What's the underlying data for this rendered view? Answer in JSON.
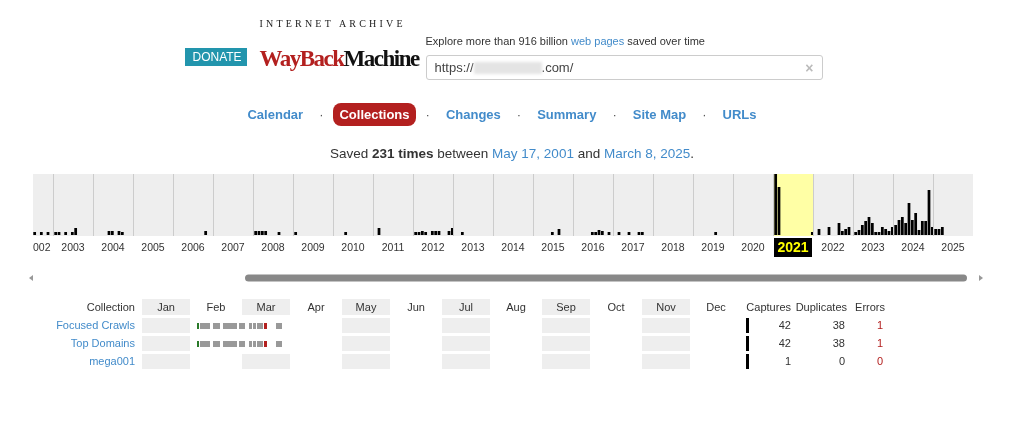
{
  "donate_button": "DONATE",
  "logo": {
    "top": "INTERNET ARCHIVE",
    "word_1": "WayBack",
    "word_2": "Machine"
  },
  "tagline": {
    "before": "Explore more than 916 billion ",
    "link": "web pages",
    "after": " saved over time"
  },
  "search": {
    "value_start": "https://",
    "value_end": ".com/",
    "clear": "×"
  },
  "tab_separator": "·",
  "tabs": [
    {
      "label": "Calendar",
      "selected": false
    },
    {
      "label": "Collections",
      "selected": true
    },
    {
      "label": "Changes",
      "selected": false
    },
    {
      "label": "Summary",
      "selected": false
    },
    {
      "label": "Site Map",
      "selected": false
    },
    {
      "label": "URLs",
      "selected": false
    }
  ],
  "summary": {
    "prefix": "Saved ",
    "count": "231 times",
    "middle": " between ",
    "first": "May 17, 2001",
    "join": " and ",
    "last": "March 8, 2025",
    "end": "."
  },
  "timeline": {
    "years": [
      {
        "label": "002",
        "selected": false
      },
      {
        "label": "2003",
        "selected": false
      },
      {
        "label": "2004",
        "selected": false
      },
      {
        "label": "2005",
        "selected": false
      },
      {
        "label": "2006",
        "selected": false
      },
      {
        "label": "2007",
        "selected": false
      },
      {
        "label": "2008",
        "selected": false
      },
      {
        "label": "2009",
        "selected": false
      },
      {
        "label": "2010",
        "selected": false
      },
      {
        "label": "2011",
        "selected": false
      },
      {
        "label": "2012",
        "selected": false
      },
      {
        "label": "2013",
        "selected": false
      },
      {
        "label": "2014",
        "selected": false
      },
      {
        "label": "2015",
        "selected": false
      },
      {
        "label": "2016",
        "selected": false
      },
      {
        "label": "2017",
        "selected": false
      },
      {
        "label": "2018",
        "selected": false
      },
      {
        "label": "2019",
        "selected": false
      },
      {
        "label": "2020",
        "selected": false
      },
      {
        "label": "2021",
        "selected": true
      },
      {
        "label": "2022",
        "selected": false
      },
      {
        "label": "2023",
        "selected": false
      },
      {
        "label": "2024",
        "selected": false
      },
      {
        "label": "2025",
        "selected": false
      }
    ]
  },
  "collections": {
    "columns": [
      "Collection",
      "Jan",
      "Feb",
      "Mar",
      "Apr",
      "May",
      "Jun",
      "Jul",
      "Aug",
      "Sep",
      "Oct",
      "Nov",
      "Dec",
      "Captures",
      "Duplicates",
      "Errors"
    ],
    "rows": [
      {
        "name": "Focused Crawls",
        "activity": true,
        "captures": "42",
        "duplicates": "38",
        "errors": "1"
      },
      {
        "name": "Top Domains",
        "activity": true,
        "captures": "42",
        "duplicates": "38",
        "errors": "1"
      },
      {
        "name": "mega001",
        "activity": false,
        "captures": "1",
        "duplicates": "0",
        "errors": "0"
      }
    ]
  }
}
